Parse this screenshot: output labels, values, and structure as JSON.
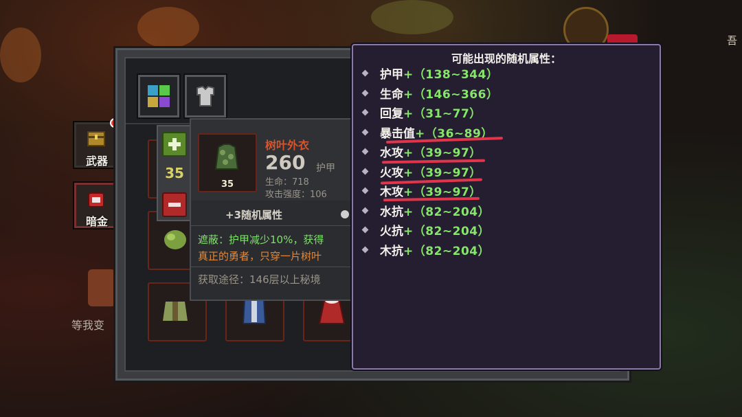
{
  "side": {
    "weapon_label": "武器",
    "dark_gold_label": "暗金"
  },
  "corner": {
    "top_right_text": "吾",
    "left_bottom_text": "等我变"
  },
  "quantity": {
    "value": "35"
  },
  "item": {
    "name": "树叶外衣",
    "armor_value": "260",
    "armor_label": "护甲",
    "slot_level": "35",
    "stat1": "生命：718",
    "stat2": "攻击强度：106",
    "random_attr": "+3随机属性",
    "effect_line1": "遮蔽：护甲减少10%，获得",
    "effect_line2": "真正的勇者，只穿一片树叶",
    "source": "获取途径：146层以上秘境"
  },
  "tooltip": {
    "title": "可能出现的随机属性：",
    "rows": [
      {
        "name": "护甲",
        "value": "+（138~344）"
      },
      {
        "name": "生命",
        "value": "+（146~366）"
      },
      {
        "name": "回复",
        "value": "+（31~77）"
      },
      {
        "name": "暴击值",
        "value": "+（36~89）"
      },
      {
        "name": "水攻",
        "value": "+（39~97）"
      },
      {
        "name": "火攻",
        "value": "+（39~97）"
      },
      {
        "name": "木攻",
        "value": "+（39~97）"
      },
      {
        "name": "水抗",
        "value": "+（82~204）"
      },
      {
        "name": "火抗",
        "value": "+（82~204）"
      },
      {
        "name": "木抗",
        "value": "+（82~204）"
      }
    ]
  },
  "colors": {
    "attr_value": "#86e66a",
    "underline": "#e0354a",
    "item_name": "#d9542a",
    "effect_green": "#7ee06a",
    "effect_orange": "#e0893a"
  }
}
